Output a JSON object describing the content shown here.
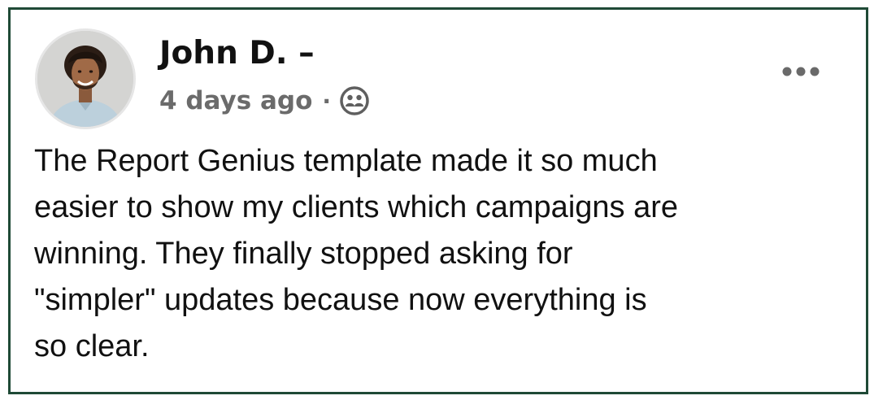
{
  "post": {
    "author": "John D. –",
    "timestamp": "4 days ago",
    "separator": "·",
    "audience_icon": "friends-icon",
    "more_icon": "more-options-icon",
    "text": "The Report Genius template made it so much\neasier to show my clients which campaigns are\nwinning. They finally stopped asking for\n\"simpler\" updates because now everything is\nso clear."
  },
  "colors": {
    "border": "#1f4a36",
    "meta_text": "#6b6b6b",
    "body_text": "#111111"
  }
}
